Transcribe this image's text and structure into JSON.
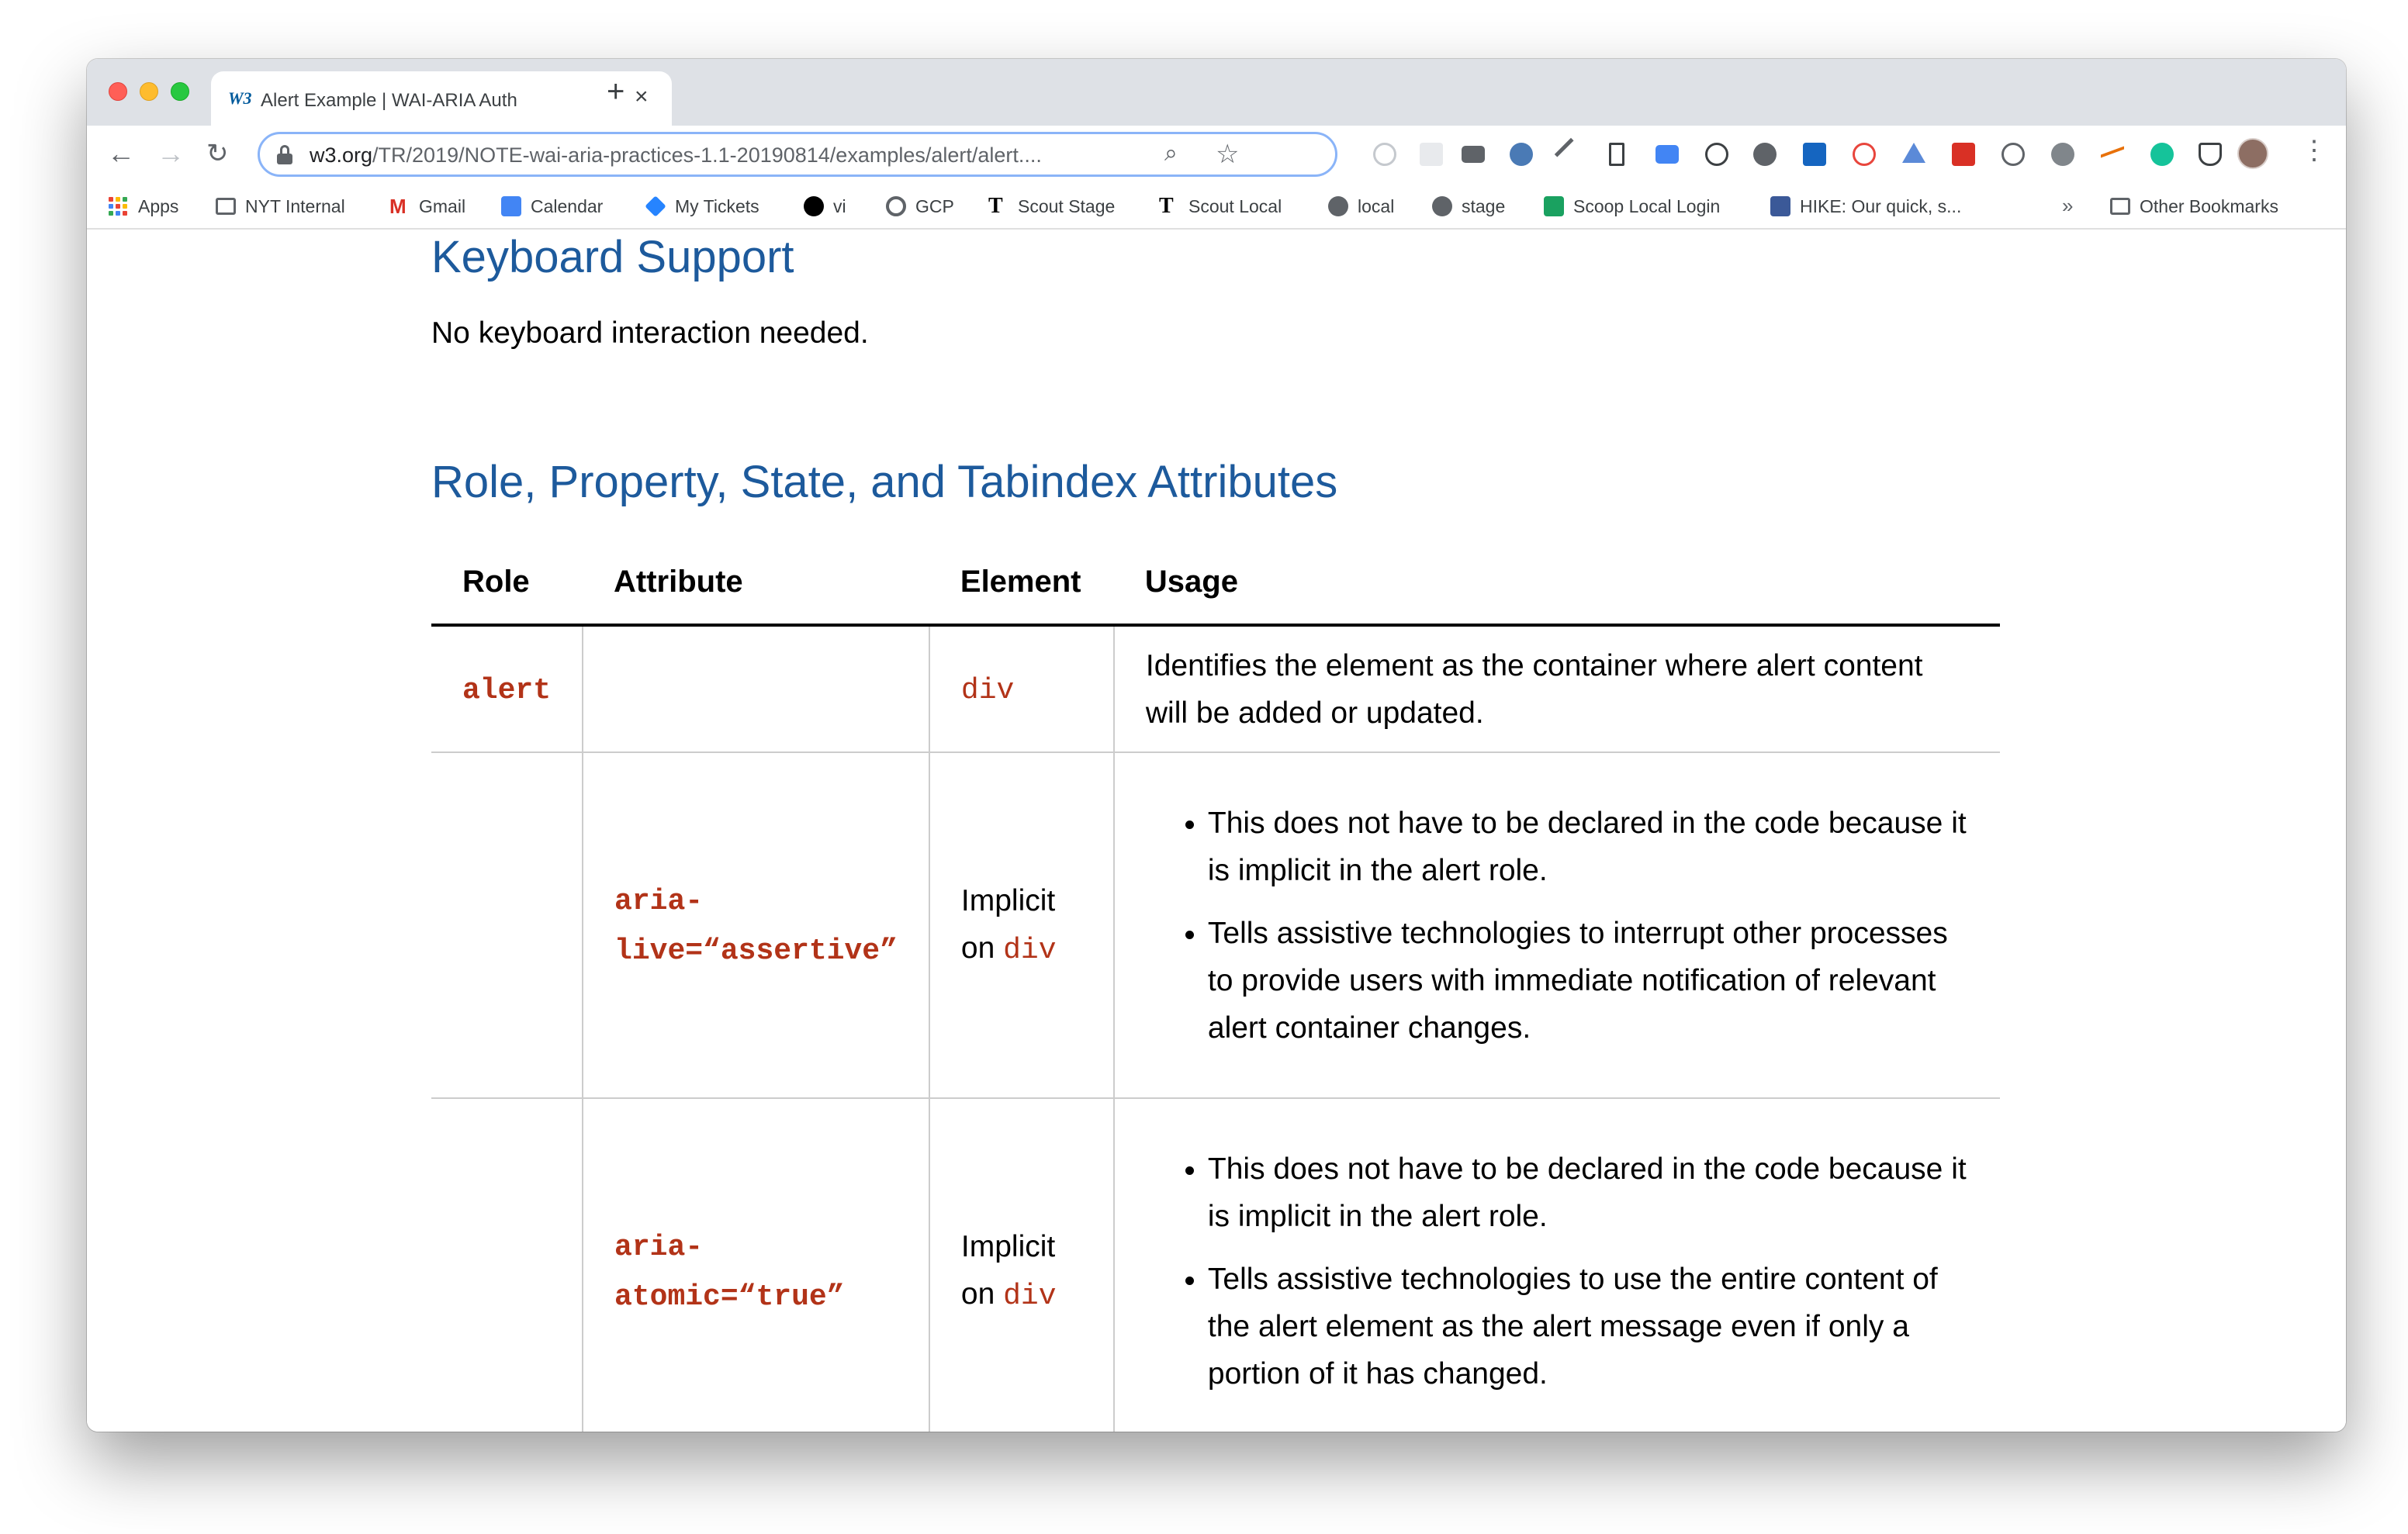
{
  "browser": {
    "tab": {
      "title": "Alert Example | WAI-ARIA Auth",
      "favicon": "W3"
    },
    "url": {
      "host": "w3.org",
      "path": "/TR/2019/NOTE-wai-aria-practices-1.1-20190814/examples/alert/alert...."
    },
    "bookmarks": [
      {
        "label": "Apps",
        "icon": "apps-grid-icon"
      },
      {
        "label": "NYT Internal",
        "icon": "folder-icon"
      },
      {
        "label": "Gmail",
        "icon": "gmail-icon"
      },
      {
        "label": "Calendar",
        "icon": "calendar-icon"
      },
      {
        "label": "My Tickets",
        "icon": "jira-icon"
      },
      {
        "label": "vi",
        "icon": "github-icon"
      },
      {
        "label": "GCP",
        "icon": "gcp-icon"
      },
      {
        "label": "Scout Stage",
        "icon": "nyt-icon"
      },
      {
        "label": "Scout Local",
        "icon": "nyt-icon"
      },
      {
        "label": "local",
        "icon": "globe-icon"
      },
      {
        "label": "stage",
        "icon": "globe-icon"
      },
      {
        "label": "Scoop Local Login",
        "icon": "scoop-icon"
      },
      {
        "label": "HIKE: Our quick, s...",
        "icon": "facebook-icon"
      }
    ],
    "bookmarks_overflow": "»",
    "other_bookmarks": "Other Bookmarks"
  },
  "page": {
    "keyboard_heading": "Keyboard Support",
    "keyboard_text": "No keyboard interaction needed.",
    "roles_heading": "Role, Property, State, and Tabindex Attributes",
    "table": {
      "headers": [
        "Role",
        "Attribute",
        "Element",
        "Usage"
      ],
      "rows": [
        {
          "role": "alert",
          "attribute": "",
          "element_prefix": "",
          "element_code": "div",
          "usage_text": "Identifies the element as the container where alert content will be added or updated."
        },
        {
          "role": "",
          "attribute": "aria-live=“assertive”",
          "element_prefix": "Implicit on ",
          "element_code": "div",
          "usage_list": [
            "This does not have to be declared in the code because it is implicit in the alert role.",
            "Tells assistive technologies to interrupt other processes to provide users with immediate notification of relevant alert container changes."
          ]
        },
        {
          "role": "",
          "attribute": "aria-atomic=“true”",
          "element_prefix": "Implicit on ",
          "element_code": "div",
          "usage_list": [
            "This does not have to be declared in the code because it is implicit in the alert role.",
            "Tells assistive technologies to use the entire content of the alert element as the alert message even if only a portion of it has changed."
          ]
        }
      ]
    }
  },
  "colors": {
    "heading": "#1d5a9c",
    "code": "#b23318",
    "omnibox_focus": "#8ab4f8"
  }
}
